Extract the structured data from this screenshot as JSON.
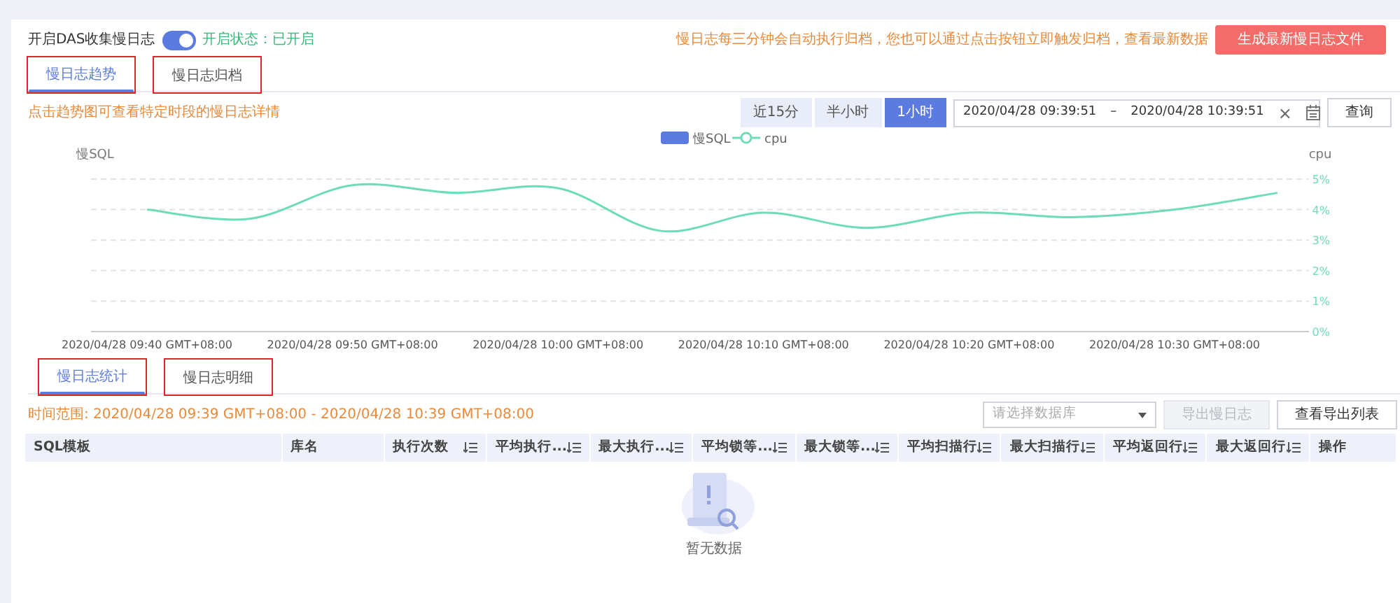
{
  "collect": {
    "label": "开启DAS收集慢日志",
    "on": true,
    "status": "开启状态：已开启"
  },
  "archive_note": "慢日志每三分钟会自动执行归档，您也可以通过点击按钮立即触发归档，查看最新数据",
  "generate_button": "生成最新慢日志文件",
  "main_tabs": [
    {
      "label": "慢日志趋势",
      "selected": true,
      "highlighted": true
    },
    {
      "label": "慢日志归档",
      "selected": false,
      "highlighted": true
    }
  ],
  "trend_hint": "点击趋势图可查看特定时段的慢日志详情",
  "range_buttons": [
    {
      "label": "近15分",
      "selected": false
    },
    {
      "label": "半小时",
      "selected": false
    },
    {
      "label": "1小时",
      "selected": true
    }
  ],
  "date_range": {
    "start": "2020/04/28 09:39:51",
    "separator": "–",
    "end": "2020/04/28 10:39:51",
    "clear": "×"
  },
  "query_button": "查询",
  "chart": {
    "left_axis": "慢SQL",
    "right_axis": "cpu",
    "chart_data": {
      "type": "line",
      "categories": [
        "2020/04/28 09:40 GMT+08:00",
        null,
        "2020/04/28 09:50 GMT+08:00",
        null,
        "2020/04/28 10:00 GMT+08:00",
        null,
        "2020/04/28 10:10 GMT+08:00",
        null,
        "2020/04/28 10:20 GMT+08:00",
        null,
        "2020/04/28 10:30 GMT+08:00",
        null
      ],
      "series": [
        {
          "name": "慢SQL",
          "color": "#5b7be0",
          "values": [
            null,
            null,
            null,
            null,
            null,
            null,
            null,
            null,
            null,
            null,
            null,
            null
          ]
        },
        {
          "name": "cpu",
          "color": "#6fdcb8",
          "values": [
            4.0,
            3.7,
            4.8,
            4.55,
            4.7,
            3.3,
            3.9,
            3.4,
            3.9,
            3.75,
            4.0,
            4.55
          ]
        }
      ],
      "ylim": [
        0,
        5
      ],
      "grid": true,
      "yticks": [
        {
          "value": 0,
          "label": "0%"
        },
        {
          "value": 1,
          "label": "1%"
        },
        {
          "value": 2,
          "label": "2%"
        },
        {
          "value": 3,
          "label": "3%"
        },
        {
          "value": 4,
          "label": "4%"
        },
        {
          "value": 5,
          "label": "5%"
        }
      ]
    }
  },
  "sub_tabs": [
    {
      "label": "慢日志统计",
      "selected": true,
      "highlighted": true
    },
    {
      "label": "慢日志明细",
      "selected": false,
      "highlighted": true
    }
  ],
  "time_range": "时间范围: 2020/04/28 09:39 GMT+08:00 - 2020/04/28 10:39 GMT+08:00",
  "database_select": {
    "placeholder": "请选择数据库"
  },
  "export_button": {
    "label": "导出慢日志",
    "disabled": true
  },
  "export_list_button": {
    "label": "查看导出列表",
    "disabled": false
  },
  "table": {
    "columns": [
      {
        "label": "SQL模板",
        "sortable": false
      },
      {
        "label": "库名",
        "sortable": false
      },
      {
        "label": "执行次数",
        "sortable": true
      },
      {
        "label": "平均执行...",
        "sortable": true
      },
      {
        "label": "最大执行...",
        "sortable": true
      },
      {
        "label": "平均锁等...",
        "sortable": true
      },
      {
        "label": "最大锁等...",
        "sortable": true
      },
      {
        "label": "平均扫描行",
        "sortable": true
      },
      {
        "label": "最大扫描行",
        "sortable": true
      },
      {
        "label": "平均返回行",
        "sortable": true
      },
      {
        "label": "最大返回行",
        "sortable": true
      },
      {
        "label": "操作",
        "sortable": false
      }
    ],
    "empty_text": "暂无数据"
  }
}
